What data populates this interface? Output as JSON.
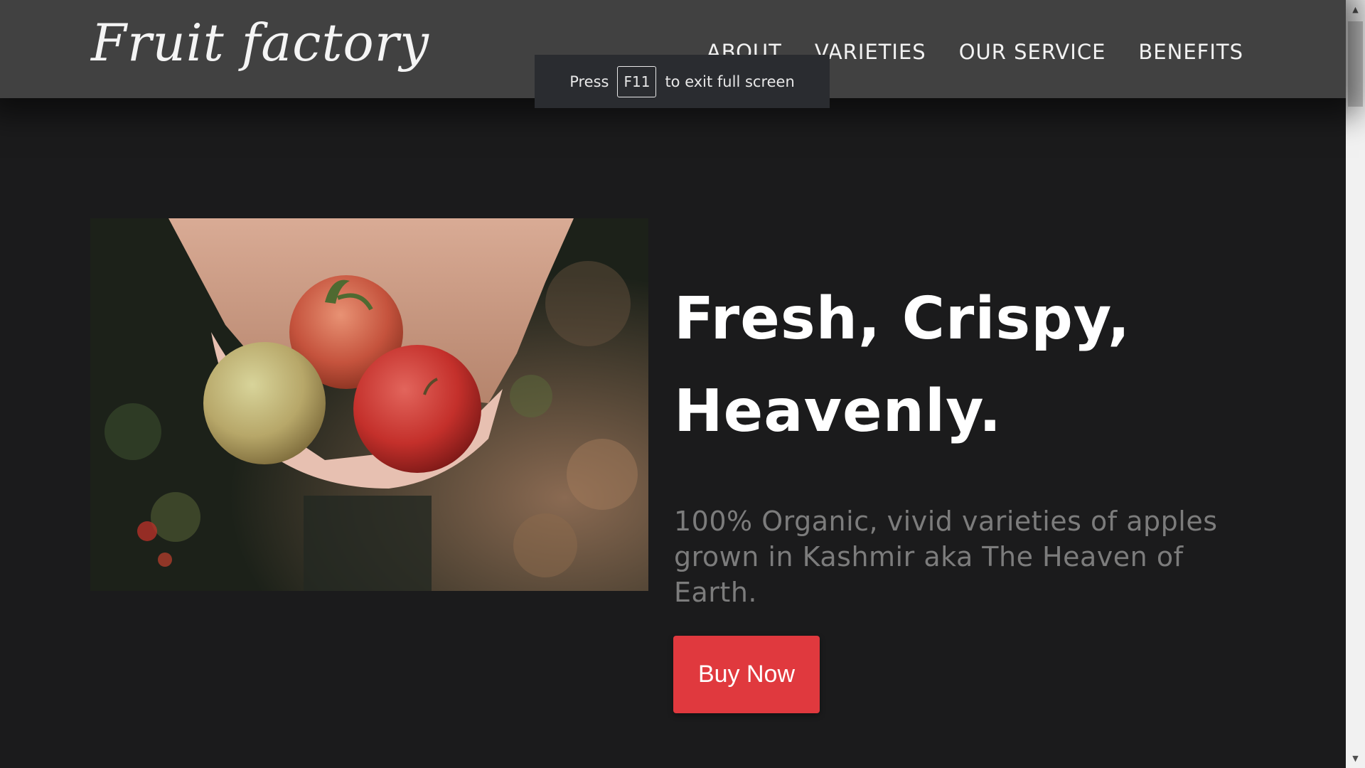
{
  "brand": {
    "logo_text": "Fruit factory"
  },
  "nav": {
    "items": [
      {
        "label": "ABOUT"
      },
      {
        "label": "VARIETIES"
      },
      {
        "label": "OUR SERVICE"
      },
      {
        "label": "BENEFITS"
      }
    ]
  },
  "fullscreen_notice": {
    "prefix": "Press",
    "key": "F11",
    "suffix": "to exit full screen"
  },
  "hero": {
    "headline_line1": "Fresh, Crispy,",
    "headline_line2": "Heavenly.",
    "subtext": "100% Organic, vivid varieties of apples grown in Kashmir aka The Heaven of Earth.",
    "cta_label": "Buy Now",
    "image_subject": "hands-holding-apples"
  },
  "colors": {
    "background": "#1b1b1c",
    "navbar": "#414141",
    "accent": "#e0393e",
    "subtext": "#7c7c7c"
  }
}
